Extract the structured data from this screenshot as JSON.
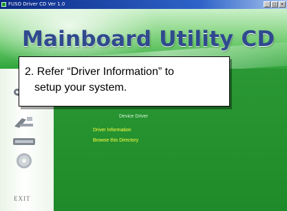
{
  "window": {
    "title": "FUSO Driver CD Ver 1.0",
    "controls": [
      "_",
      "□",
      "×"
    ]
  },
  "header": {
    "title": "Mainboard Utility CD"
  },
  "sidebar": {
    "items": [
      {
        "name": "tools",
        "icon": "tools-icon"
      },
      {
        "name": "manual",
        "icon": "manual-icon"
      },
      {
        "name": "readme",
        "icon": "readme-icon"
      },
      {
        "name": "cd",
        "icon": "cd-icon"
      },
      {
        "name": "exit",
        "label": "EXIT",
        "icon": "exit-icon"
      }
    ]
  },
  "menu": {
    "items": [
      {
        "label": "Device Driver",
        "color": "#ffffff"
      },
      {
        "label": "Driver Information",
        "color": "#ffff44"
      },
      {
        "label": "Browse this Directory",
        "color": "#ffff44"
      }
    ]
  },
  "callout": {
    "line1": "2. Refer “Driver Information” to",
    "line2": "setup your system."
  }
}
